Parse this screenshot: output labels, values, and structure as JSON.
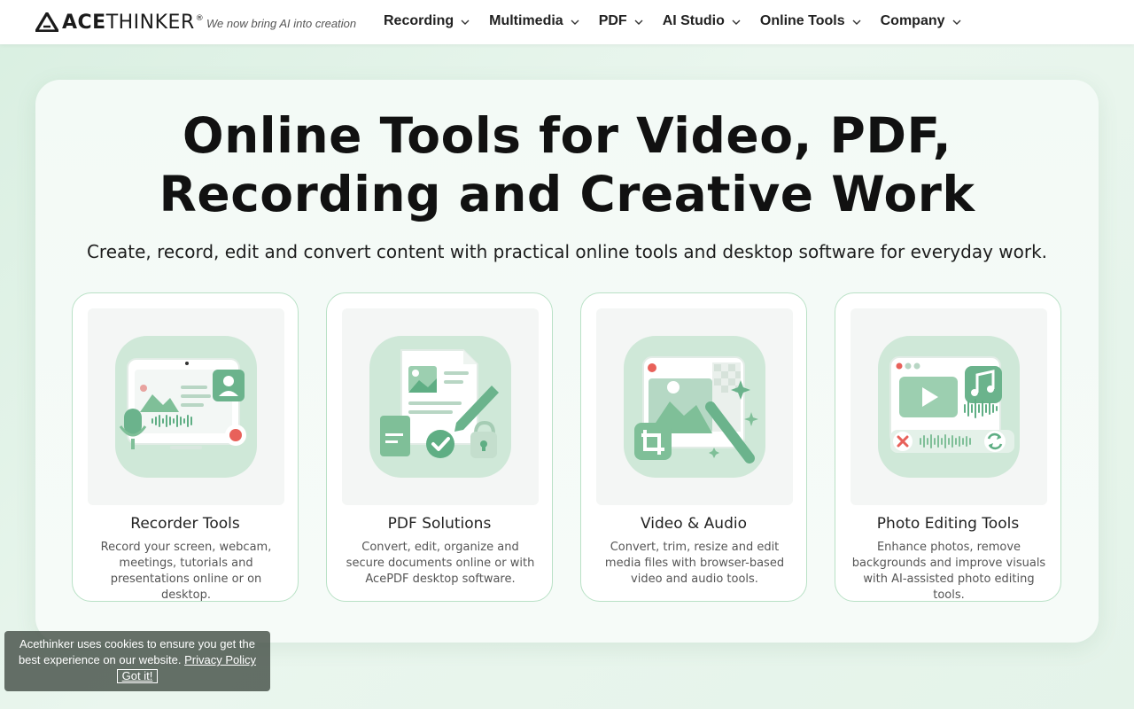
{
  "header": {
    "logo_bold": "ACE",
    "logo_light": "THINKER",
    "logo_reg": "®",
    "tagline": "We now bring AI into creation",
    "nav": [
      {
        "label": "Recording"
      },
      {
        "label": "Multimedia"
      },
      {
        "label": "PDF"
      },
      {
        "label": "AI Studio"
      },
      {
        "label": "Online Tools"
      },
      {
        "label": "Company"
      }
    ]
  },
  "hero": {
    "title_line1": "Online Tools for Video, PDF,",
    "title_line2": "Recording and Creative Work",
    "subtitle": "Create, record, edit and convert content with practical online tools and desktop software for everyday work."
  },
  "cards": [
    {
      "title": "Recorder Tools",
      "desc": "Record your screen, webcam, meetings, tutorials and presentations online or on desktop.",
      "icon": "recorder-illustration-icon"
    },
    {
      "title": "PDF Solutions",
      "desc": "Convert, edit, organize and secure documents online or with AcePDF desktop software.",
      "icon": "pdf-illustration-icon"
    },
    {
      "title": "Video & Audio",
      "desc": "Convert, trim, resize and edit media files with browser-based video and audio tools.",
      "icon": "video-audio-illustration-icon"
    },
    {
      "title": "Photo Editing Tools",
      "desc": "Enhance photos, remove backgrounds and improve visuals with AI-assisted photo editing tools.",
      "icon": "photo-editing-illustration-icon"
    }
  ],
  "cookie": {
    "text": "Acethinker uses cookies to ensure you get the best experience on our website.",
    "link": "Privacy Policy",
    "button": "Got it!"
  },
  "colors": {
    "accent_green": "#5fae84",
    "card_border": "#b9e1c6",
    "illustration_bg": "#cfe8d8",
    "record_red": "#e8615a"
  }
}
